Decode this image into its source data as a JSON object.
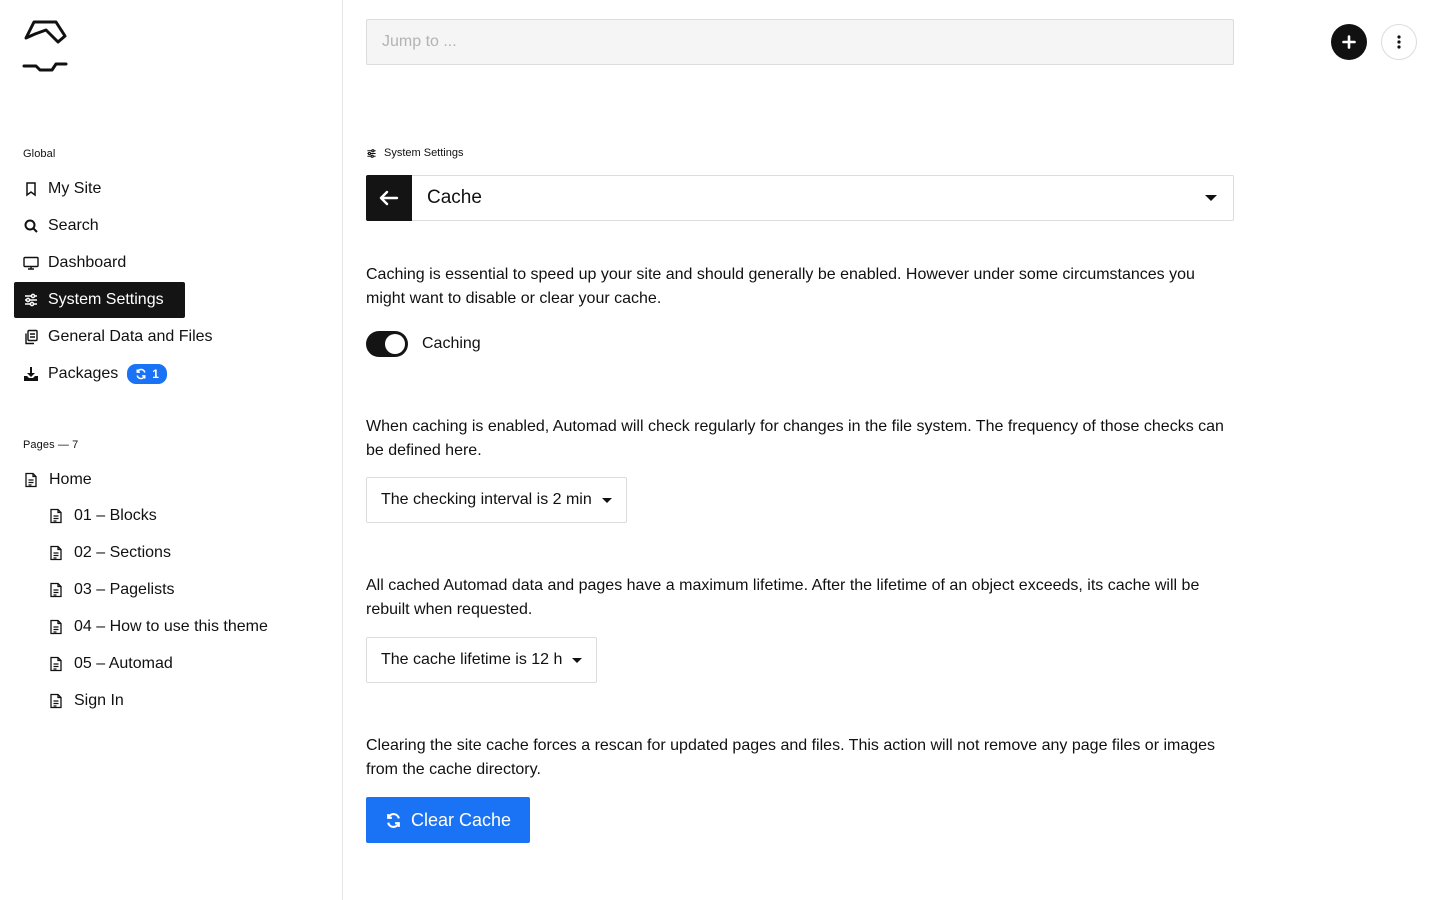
{
  "sidebar": {
    "global_label": "Global",
    "nav": [
      {
        "label": "My Site",
        "icon": "bookmark-icon"
      },
      {
        "label": "Search",
        "icon": "search-icon"
      },
      {
        "label": "Dashboard",
        "icon": "monitor-icon"
      },
      {
        "label": "System Settings",
        "icon": "sliders-icon",
        "active": true
      },
      {
        "label": "General Data and Files",
        "icon": "files-icon"
      },
      {
        "label": "Packages",
        "icon": "download-icon",
        "badge": "1"
      }
    ],
    "pages_label": "Pages — 7",
    "pages": [
      {
        "label": "Home"
      },
      {
        "label": "01 – Blocks"
      },
      {
        "label": "02 – Sections"
      },
      {
        "label": "03 – Pagelists"
      },
      {
        "label": "04 – How to use this theme"
      },
      {
        "label": "05 – Automad"
      },
      {
        "label": "Sign In"
      }
    ]
  },
  "topbar": {
    "jump_placeholder": "Jump to ..."
  },
  "main": {
    "breadcrumb": "System Settings",
    "selected_section": "Cache",
    "intro": "Caching is essential to speed up your site and should generally be enabled. However under some circumstances you might want to disable or clear your cache.",
    "caching_toggle_label": "Caching",
    "caching_enabled": true,
    "interval_text": "When caching is enabled, Automad will check regularly for changes in the file system. The frequency of those checks can be defined here.",
    "interval_select": "The checking interval is 2 min",
    "lifetime_text": "All cached Automad data and pages have a maximum lifetime. After the lifetime of an object exceeds, its cache will be rebuilt when requested.",
    "lifetime_select": "The cache lifetime is 12 h",
    "clear_text": "Clearing the site cache forces a rescan for updated pages and files. This action will not remove any page files or images from the cache directory.",
    "clear_button": "Clear Cache",
    "cutoff_text": ""
  },
  "colors": {
    "accent": "#1a73f5",
    "dark": "#141414",
    "border": "#dcdcdc"
  }
}
